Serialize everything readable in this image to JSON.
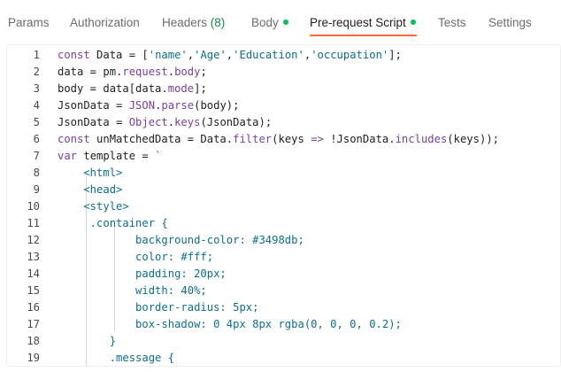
{
  "tabs": [
    {
      "label": "Params",
      "active": false
    },
    {
      "label": "Authorization",
      "active": false
    },
    {
      "label": "Headers",
      "count": "(8)",
      "active": false
    },
    {
      "label": "Body",
      "dot": true,
      "active": false
    },
    {
      "label": "Pre-request Script",
      "dot": true,
      "active": true
    },
    {
      "label": "Tests",
      "active": false
    },
    {
      "label": "Settings",
      "active": false
    }
  ],
  "colors": {
    "accent": "#ff6c37",
    "dot": "#0cbb52",
    "count": "#0f8a4b",
    "keyword": "#7a3e9d",
    "string": "#0d6e8c"
  },
  "editor": {
    "lines": [
      {
        "num": "1",
        "tokens": [
          [
            "kw",
            "const"
          ],
          [
            "p",
            " Data = ["
          ],
          [
            "str",
            "'name'"
          ],
          [
            "p",
            ","
          ],
          [
            "str",
            "'Age'"
          ],
          [
            "p",
            ","
          ],
          [
            "str",
            "'Education'"
          ],
          [
            "p",
            ","
          ],
          [
            "str",
            "'occupation'"
          ],
          [
            "p",
            "];"
          ]
        ]
      },
      {
        "num": "2",
        "tokens": [
          [
            "p",
            "data = pm."
          ],
          [
            "prop",
            "request"
          ],
          [
            "p",
            "."
          ],
          [
            "prop",
            "body"
          ],
          [
            "p",
            ";"
          ]
        ]
      },
      {
        "num": "3",
        "tokens": [
          [
            "p",
            "body = data[data."
          ],
          [
            "prop",
            "mode"
          ],
          [
            "p",
            "];"
          ]
        ]
      },
      {
        "num": "4",
        "tokens": [
          [
            "p",
            "JsonData = "
          ],
          [
            "prop",
            "JSON"
          ],
          [
            "p",
            "."
          ],
          [
            "fn",
            "parse"
          ],
          [
            "p",
            "(body);"
          ]
        ]
      },
      {
        "num": "5",
        "tokens": [
          [
            "p",
            "JsonData = "
          ],
          [
            "prop",
            "Object"
          ],
          [
            "p",
            "."
          ],
          [
            "fn",
            "keys"
          ],
          [
            "p",
            "(JsonData);"
          ]
        ]
      },
      {
        "num": "6",
        "tokens": [
          [
            "kw",
            "const"
          ],
          [
            "p",
            " unMatchedData = Data."
          ],
          [
            "prop",
            "filter"
          ],
          [
            "p",
            "(keys "
          ],
          [
            "kw",
            "=>"
          ],
          [
            "p",
            " !JsonData."
          ],
          [
            "prop",
            "includes"
          ],
          [
            "p",
            "(keys));"
          ]
        ]
      },
      {
        "num": "7",
        "tokens": [
          [
            "kw",
            "var"
          ],
          [
            "p",
            " template = "
          ],
          [
            "str",
            "`"
          ]
        ]
      },
      {
        "num": "8",
        "tokens": [
          [
            "str",
            "    <html>"
          ]
        ]
      },
      {
        "num": "9",
        "tokens": [
          [
            "str",
            "    <head>"
          ]
        ]
      },
      {
        "num": "10",
        "tokens": [
          [
            "str",
            "    <style>"
          ]
        ]
      },
      {
        "num": "11",
        "tokens": [
          [
            "str",
            "     .container {"
          ]
        ]
      },
      {
        "num": "12",
        "tokens": [
          [
            "str",
            "            background-color: #3498db;"
          ]
        ]
      },
      {
        "num": "13",
        "tokens": [
          [
            "str",
            "            color: #fff;"
          ]
        ]
      },
      {
        "num": "14",
        "tokens": [
          [
            "str",
            "            padding: 20px;"
          ]
        ]
      },
      {
        "num": "15",
        "tokens": [
          [
            "str",
            "            width: 40%;"
          ]
        ]
      },
      {
        "num": "16",
        "tokens": [
          [
            "str",
            "            border-radius: 5px;"
          ]
        ]
      },
      {
        "num": "17",
        "tokens": [
          [
            "str",
            "            box-shadow: 0 4px 8px rgba(0, 0, 0, 0.2);"
          ]
        ]
      },
      {
        "num": "18",
        "tokens": [
          [
            "str",
            "        }"
          ]
        ]
      },
      {
        "num": "19",
        "tokens": [
          [
            "str",
            "        .message {"
          ]
        ]
      }
    ]
  }
}
